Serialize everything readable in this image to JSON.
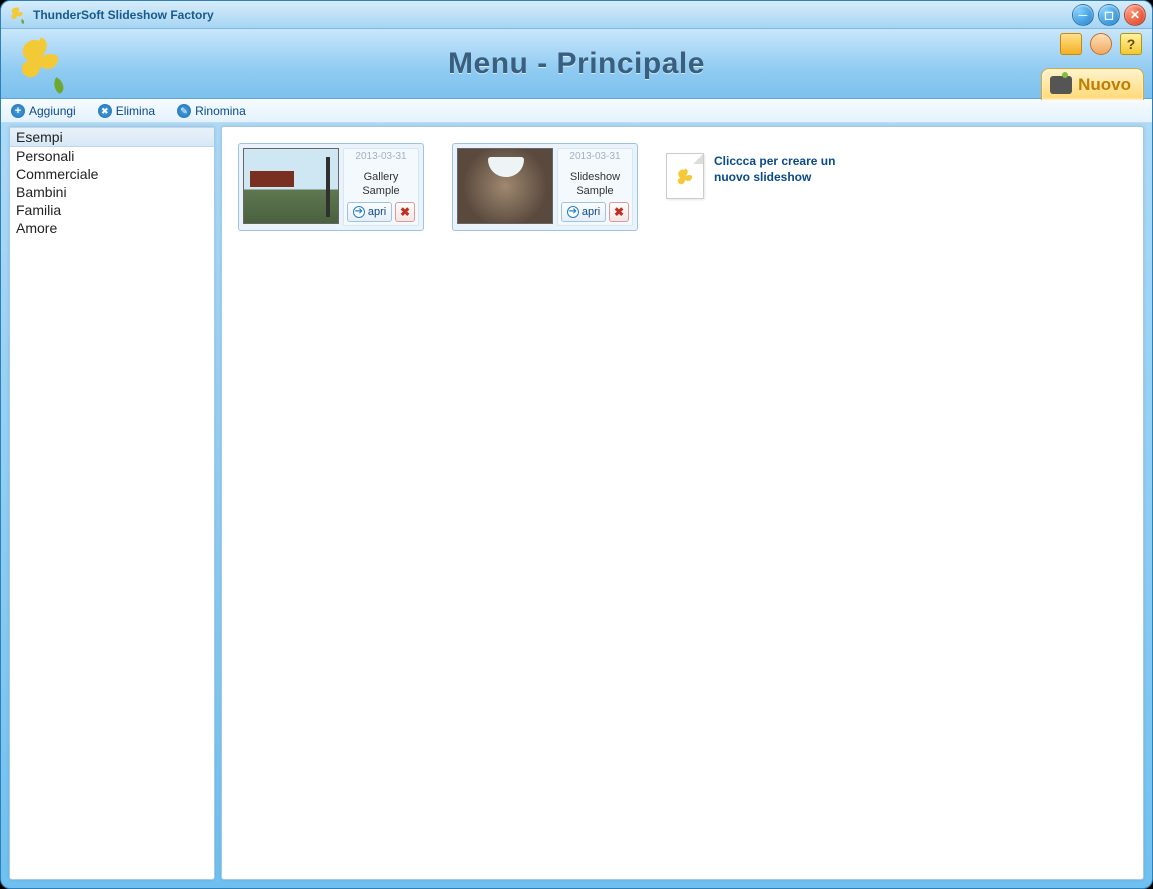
{
  "app": {
    "title": "ThunderSoft Slideshow Factory"
  },
  "header": {
    "title": "Menu - Principale",
    "nuovo_label": "Nuovo"
  },
  "toolbar": {
    "add": "Aggiungi",
    "delete": "Elimina",
    "rename": "Rinomina"
  },
  "sidebar": {
    "items": [
      {
        "label": "Esempi",
        "selected": true
      },
      {
        "label": "Personali",
        "selected": false
      },
      {
        "label": "Commerciale",
        "selected": false
      },
      {
        "label": "Bambini",
        "selected": false
      },
      {
        "label": "Familia",
        "selected": false
      },
      {
        "label": "Amore",
        "selected": false
      }
    ]
  },
  "cards": [
    {
      "date": "2013-03-31",
      "title": "Gallery Sample",
      "open_label": "apri",
      "thumb": "gallery"
    },
    {
      "date": "2013-03-31",
      "title": "Slideshow Sample",
      "open_label": "apri",
      "thumb": "slideshow"
    }
  ],
  "new_slideshow": {
    "text": "Cliccca per creare un nuovo slideshow"
  }
}
